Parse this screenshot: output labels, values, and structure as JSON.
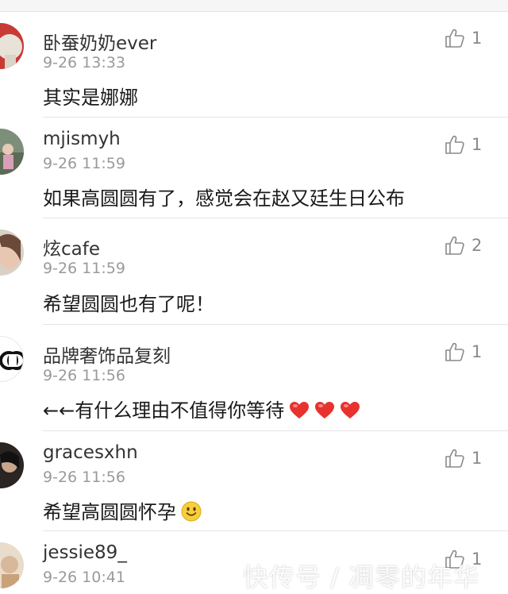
{
  "comments": [
    {
      "username": "卧蚕奶奶ever",
      "time": "9-26 13:33",
      "content": "其实是娜娜",
      "likes": "1",
      "avatar_icon": "avatar-red-photo"
    },
    {
      "username": "mjismyh",
      "time": "9-26 11:59",
      "content": "如果高圆圆有了，感觉会在赵又廷生日公布",
      "likes": "1",
      "avatar_icon": "avatar-outdoor-photo"
    },
    {
      "username": "炫cafe",
      "time": "9-26 11:59",
      "content": "希望圆圆也有了呢！",
      "likes": "2",
      "avatar_icon": "avatar-portrait-photo"
    },
    {
      "username": "品牌奢饰品复刻",
      "time": "9-26 11:56",
      "content": "←←有什么理由不值得你等待",
      "likes": "1",
      "avatar_icon": "avatar-chanel-logo",
      "content_emoji": "heart-emoji x3"
    },
    {
      "username": "gracesxhn",
      "time": "9-26 11:56",
      "content": "希望高圆圆怀孕",
      "likes": "1",
      "avatar_icon": "avatar-dark-photo",
      "content_emoji": "smile-emoji"
    },
    {
      "username": "jessie89_",
      "time": "9-26 10:41",
      "content": "",
      "likes": "1",
      "avatar_icon": "avatar-light-photo"
    }
  ],
  "watermark": "快传号 / 凋零的年华",
  "colors": {
    "username": "#333333",
    "time": "#9a9a9a",
    "content": "#1a1a1a",
    "like": "#8a8a8a",
    "divider": "#e4e4e4",
    "heart": "#e8322e"
  }
}
